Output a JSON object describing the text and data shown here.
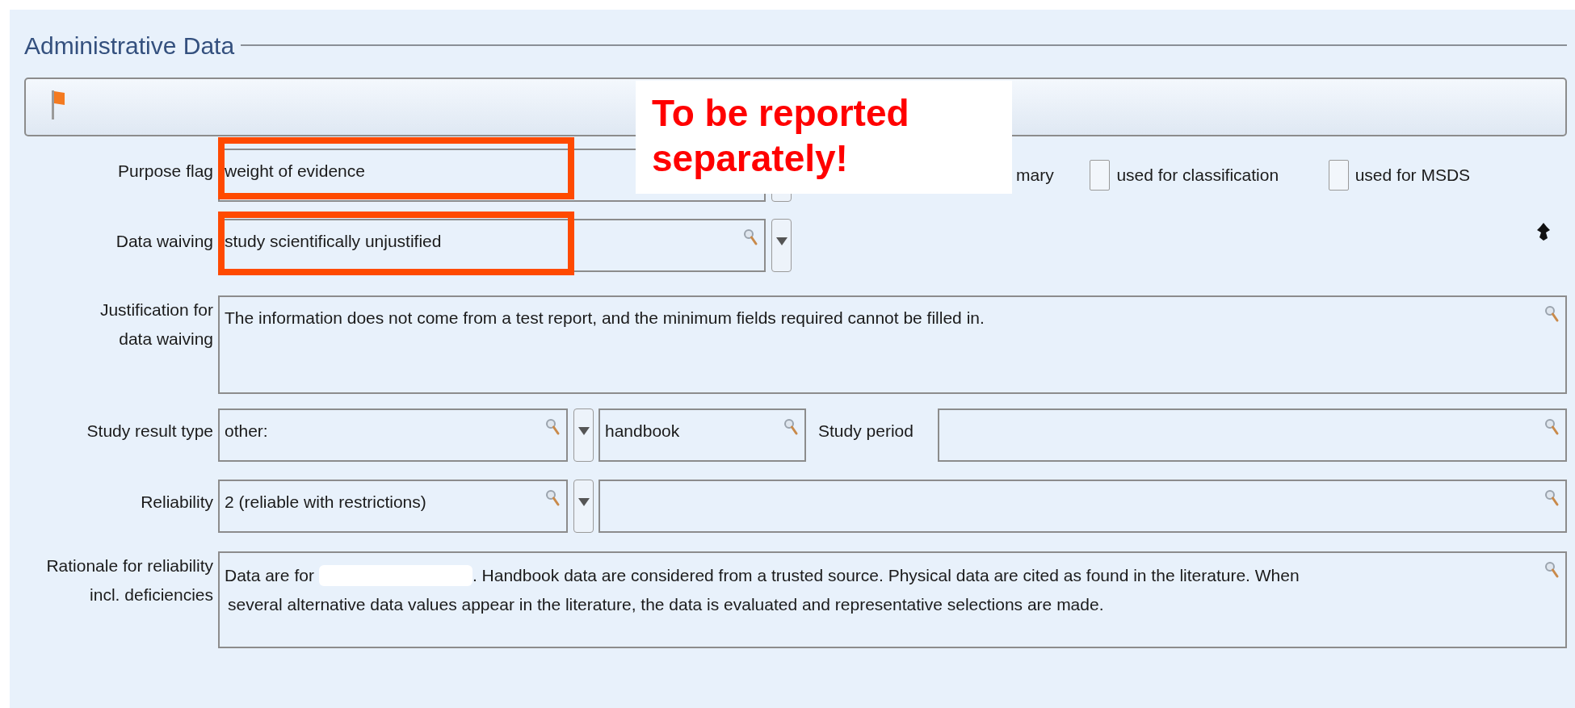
{
  "section": {
    "title": "Administrative Data"
  },
  "annotation": {
    "note": "To be reported separately!"
  },
  "purpose_flag": {
    "label": "Purpose flag",
    "value": "weight of evidence",
    "checkboxes": [
      {
        "label": "mary",
        "kind": "partial"
      },
      {
        "label": "used for classification",
        "checked": false,
        "kind": "full"
      },
      {
        "label": "used for MSDS",
        "checked": false,
        "kind": "full"
      }
    ]
  },
  "data_waiving": {
    "label": "Data waiving",
    "value": "study scientifically unjustified"
  },
  "justification": {
    "label": "Justification for data waiving",
    "value": "The information does not come from a test report, and the minimum fields required cannot be filled in."
  },
  "study_result_type": {
    "label": "Study result type",
    "value": "other:",
    "detail": "handbook",
    "period_label": "Study period"
  },
  "reliability": {
    "label": "Reliability",
    "value": "2 (reliable with restrictions)"
  },
  "rationale": {
    "label": "Rationale for reliability incl. deficiencies",
    "before": "Data are for",
    "lines": [
      ". Handbook data are considered from a trusted source. Physical data are cited as found in the literature. When",
      "several alternative data values appear in the literature, the data is evaluated and representative selections are made."
    ]
  }
}
